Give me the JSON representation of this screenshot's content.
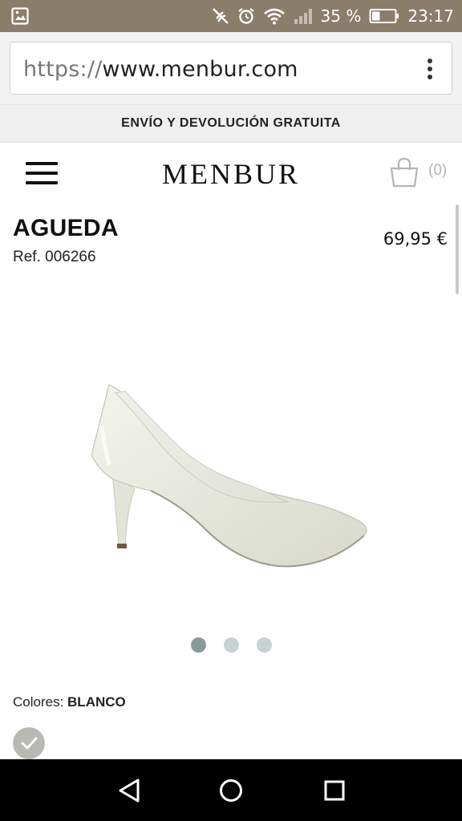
{
  "status_bar": {
    "battery_percent": "35 %",
    "time": "23:17",
    "battery_level": 0.35
  },
  "browser": {
    "url_scheme": "https://",
    "url_host": "www.menbur.com"
  },
  "promo": {
    "text": "ENVÍO Y DEVOLUCIÓN GRATUITA"
  },
  "header": {
    "logo": "MENBUR",
    "cart_count": "(0)"
  },
  "product": {
    "name": "AGUEDA",
    "ref": "Ref. 006266",
    "price": "69,95 €",
    "colors_label": "Colores:",
    "color_value": "BLANCO",
    "gallery_count": 3,
    "gallery_active": 1
  },
  "colors": {
    "status_bar_bg": "#8a7d6a",
    "dot_active": "#879a98",
    "dot_inactive": "#c7d3d3",
    "swatch": "#b9b9b4"
  },
  "icons": {
    "status_left": "screenshot-icon",
    "nav_back": "back-triangle-icon",
    "nav_home": "home-circle-icon",
    "nav_recents": "recents-square-icon"
  }
}
